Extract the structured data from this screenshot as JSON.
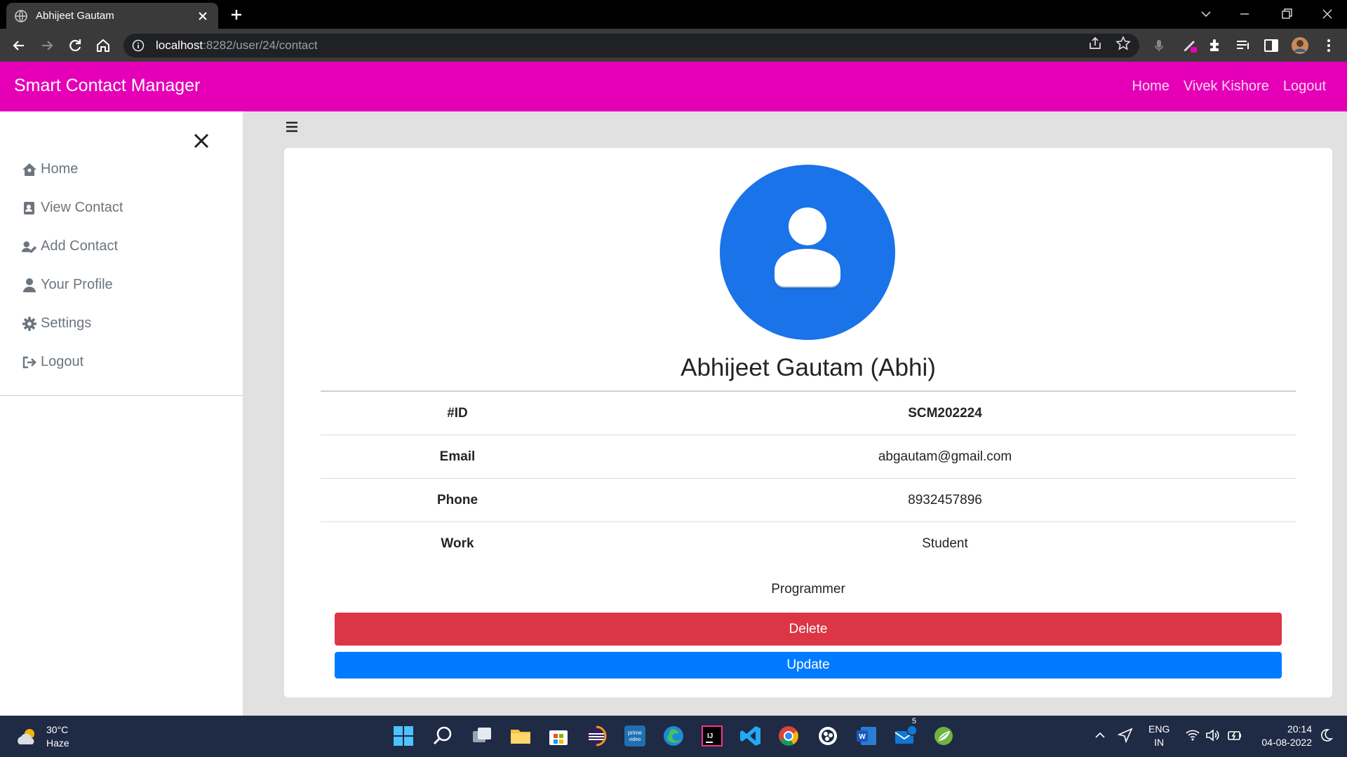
{
  "browser": {
    "tab_title": "Abhijeet Gautam",
    "url_host": "localhost",
    "url_path": ":8282/user/24/contact"
  },
  "app": {
    "brand": "Smart Contact Manager",
    "nav": [
      "Home",
      "Vivek Kishore",
      "Logout"
    ],
    "accent_color": "#e500b8"
  },
  "sidebar": {
    "items": [
      {
        "label": "Home",
        "icon": "home-icon"
      },
      {
        "label": "View Contact",
        "icon": "address-book-icon"
      },
      {
        "label": "Add Contact",
        "icon": "user-edit-icon"
      },
      {
        "label": "Your Profile",
        "icon": "user-icon"
      },
      {
        "label": "Settings",
        "icon": "gear-icon"
      },
      {
        "label": "Logout",
        "icon": "sign-out-icon"
      }
    ]
  },
  "contact": {
    "name": "Abhijeet Gautam (Abhi)",
    "rows": [
      {
        "label": "#ID",
        "value": "SCM202224"
      },
      {
        "label": "Email",
        "value": "abgautam@gmail.com"
      },
      {
        "label": "Phone",
        "value": "8932457896"
      },
      {
        "label": "Work",
        "value": "Student"
      }
    ],
    "description": "Programmer",
    "delete_label": "Delete",
    "update_label": "Update"
  },
  "taskbar": {
    "weather_temp": "30°C",
    "weather_desc": "Haze",
    "lang_line1": "ENG",
    "lang_line2": "IN",
    "time": "20:14",
    "date": "04-08-2022",
    "mail_badge": "5"
  }
}
